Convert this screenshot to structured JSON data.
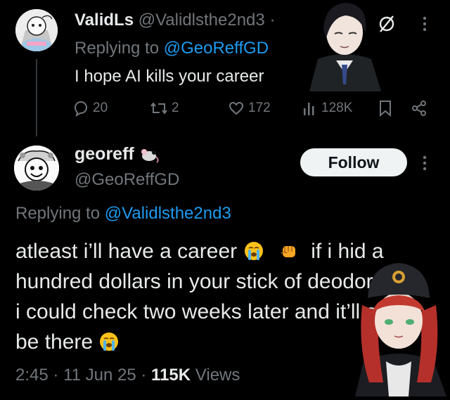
{
  "reply": {
    "display_name": "ValidLs",
    "handle": "@Validlsthe2nd3",
    "dot": "·",
    "replying_prefix": "Replying to",
    "replying_handle": "@GeoReffGD",
    "text": "I hope AI kills your career",
    "stats": {
      "replies": "20",
      "reposts": "2",
      "likes": "172",
      "views": "128K"
    }
  },
  "main": {
    "display_name": "georeff",
    "name_emoji": "mouse-emoji",
    "handle": "@GeoReffGD",
    "follow_label": "Follow",
    "replying_prefix": "Replying to",
    "replying_handle": "@Validlsthe2nd3",
    "text_part1": "atleast i’ll have a career",
    "text_part2": "if i hid",
    "text_part3": "a hundred dollars in your stick of deodorant i could check two weeks later and it’ll still be there",
    "meta_time": "2:45",
    "meta_sep": "·",
    "meta_date": "11 Jun 25",
    "meta_views_count": "115K",
    "meta_views_label": "Views"
  },
  "colors": {
    "background": "#000000",
    "text": "#e7e9ea",
    "muted": "#71767b",
    "link": "#1d9bf0",
    "follow_bg": "#eff3f4"
  },
  "icons": [
    "reply-icon",
    "repost-icon",
    "like-icon",
    "views-icon",
    "bookmark-icon",
    "share-icon",
    "more-icon",
    "grok-icon",
    "crying-emoji",
    "fist-emoji"
  ]
}
